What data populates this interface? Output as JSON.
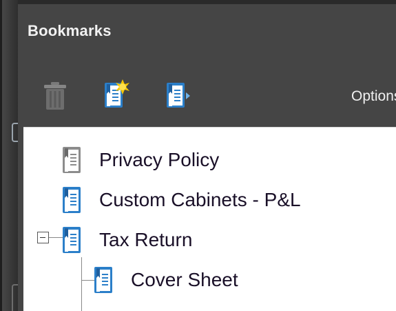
{
  "panel": {
    "title": "Bookmarks"
  },
  "toolbar": {
    "delete_icon": "trash-icon",
    "new_bookmark_icon": "new-bookmark-icon",
    "expand_bookmark_icon": "bookmark-arrow-icon",
    "options_label": "Options"
  },
  "bookmarks": [
    {
      "label": "Privacy Policy",
      "icon": "bookmark-gray-icon"
    },
    {
      "label": "Custom Cabinets - P&L",
      "icon": "bookmark-icon"
    },
    {
      "label": "Tax Return",
      "icon": "bookmark-icon",
      "expanded": true
    },
    {
      "label": "Cover Sheet",
      "icon": "bookmark-icon",
      "level": 2
    }
  ],
  "colors": {
    "panel_bg": "#454545",
    "tree_bg": "#ffffff",
    "bookmark_blue": "#2b7fc9",
    "bookmark_gray": "#8c8c8c",
    "label_text": "#1a1028"
  }
}
